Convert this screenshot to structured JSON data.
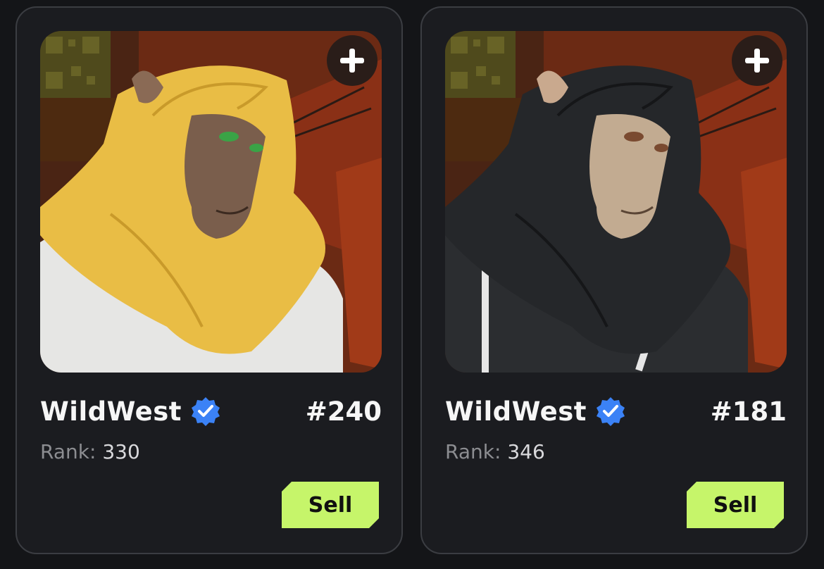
{
  "cards": [
    {
      "collection": "WildWest",
      "token_id": "#240",
      "rank_label": "Rank:",
      "rank_value": "330",
      "sell_label": "Sell",
      "fur_color": "#e9bd45",
      "fur_shade": "#c99a2a",
      "face_color": "#7a5e4c",
      "eye_color": "#3aa346",
      "clothing_color": "#e6e6e4"
    },
    {
      "collection": "WildWest",
      "token_id": "#181",
      "rank_label": "Rank:",
      "rank_value": "346",
      "sell_label": "Sell",
      "fur_color": "#25272a",
      "fur_shade": "#151618",
      "face_color": "#c2ab91",
      "eye_color": "#7a4a30",
      "clothing_color": "#2b2d30"
    }
  ],
  "icons": {
    "add": "plus-icon",
    "verified": "verified-badge-icon"
  },
  "colors": {
    "background": "#141518",
    "card": "#1b1c20",
    "sell_button": "#c6f56a",
    "verified": "#3b82f6"
  }
}
